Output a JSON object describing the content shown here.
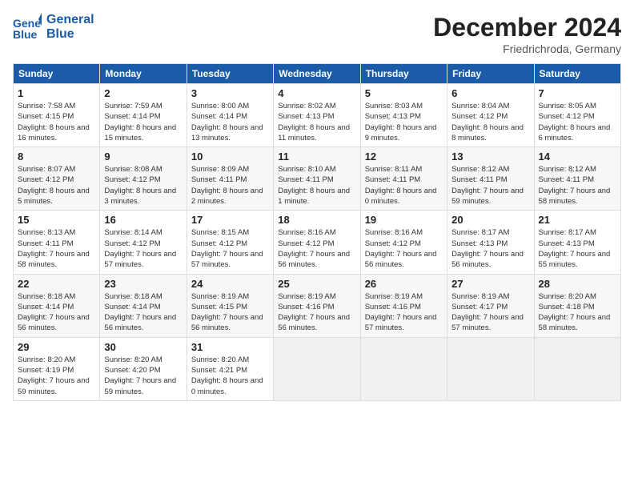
{
  "header": {
    "logo_line1": "General",
    "logo_line2": "Blue",
    "month": "December 2024",
    "location": "Friedrichroda, Germany"
  },
  "weekdays": [
    "Sunday",
    "Monday",
    "Tuesday",
    "Wednesday",
    "Thursday",
    "Friday",
    "Saturday"
  ],
  "weeks": [
    [
      {
        "day": "1",
        "sunrise": "Sunrise: 7:58 AM",
        "sunset": "Sunset: 4:15 PM",
        "daylight": "Daylight: 8 hours and 16 minutes."
      },
      {
        "day": "2",
        "sunrise": "Sunrise: 7:59 AM",
        "sunset": "Sunset: 4:14 PM",
        "daylight": "Daylight: 8 hours and 15 minutes."
      },
      {
        "day": "3",
        "sunrise": "Sunrise: 8:00 AM",
        "sunset": "Sunset: 4:14 PM",
        "daylight": "Daylight: 8 hours and 13 minutes."
      },
      {
        "day": "4",
        "sunrise": "Sunrise: 8:02 AM",
        "sunset": "Sunset: 4:13 PM",
        "daylight": "Daylight: 8 hours and 11 minutes."
      },
      {
        "day": "5",
        "sunrise": "Sunrise: 8:03 AM",
        "sunset": "Sunset: 4:13 PM",
        "daylight": "Daylight: 8 hours and 9 minutes."
      },
      {
        "day": "6",
        "sunrise": "Sunrise: 8:04 AM",
        "sunset": "Sunset: 4:12 PM",
        "daylight": "Daylight: 8 hours and 8 minutes."
      },
      {
        "day": "7",
        "sunrise": "Sunrise: 8:05 AM",
        "sunset": "Sunset: 4:12 PM",
        "daylight": "Daylight: 8 hours and 6 minutes."
      }
    ],
    [
      {
        "day": "8",
        "sunrise": "Sunrise: 8:07 AM",
        "sunset": "Sunset: 4:12 PM",
        "daylight": "Daylight: 8 hours and 5 minutes."
      },
      {
        "day": "9",
        "sunrise": "Sunrise: 8:08 AM",
        "sunset": "Sunset: 4:12 PM",
        "daylight": "Daylight: 8 hours and 3 minutes."
      },
      {
        "day": "10",
        "sunrise": "Sunrise: 8:09 AM",
        "sunset": "Sunset: 4:11 PM",
        "daylight": "Daylight: 8 hours and 2 minutes."
      },
      {
        "day": "11",
        "sunrise": "Sunrise: 8:10 AM",
        "sunset": "Sunset: 4:11 PM",
        "daylight": "Daylight: 8 hours and 1 minute."
      },
      {
        "day": "12",
        "sunrise": "Sunrise: 8:11 AM",
        "sunset": "Sunset: 4:11 PM",
        "daylight": "Daylight: 8 hours and 0 minutes."
      },
      {
        "day": "13",
        "sunrise": "Sunrise: 8:12 AM",
        "sunset": "Sunset: 4:11 PM",
        "daylight": "Daylight: 7 hours and 59 minutes."
      },
      {
        "day": "14",
        "sunrise": "Sunrise: 8:12 AM",
        "sunset": "Sunset: 4:11 PM",
        "daylight": "Daylight: 7 hours and 58 minutes."
      }
    ],
    [
      {
        "day": "15",
        "sunrise": "Sunrise: 8:13 AM",
        "sunset": "Sunset: 4:11 PM",
        "daylight": "Daylight: 7 hours and 58 minutes."
      },
      {
        "day": "16",
        "sunrise": "Sunrise: 8:14 AM",
        "sunset": "Sunset: 4:12 PM",
        "daylight": "Daylight: 7 hours and 57 minutes."
      },
      {
        "day": "17",
        "sunrise": "Sunrise: 8:15 AM",
        "sunset": "Sunset: 4:12 PM",
        "daylight": "Daylight: 7 hours and 57 minutes."
      },
      {
        "day": "18",
        "sunrise": "Sunrise: 8:16 AM",
        "sunset": "Sunset: 4:12 PM",
        "daylight": "Daylight: 7 hours and 56 minutes."
      },
      {
        "day": "19",
        "sunrise": "Sunrise: 8:16 AM",
        "sunset": "Sunset: 4:12 PM",
        "daylight": "Daylight: 7 hours and 56 minutes."
      },
      {
        "day": "20",
        "sunrise": "Sunrise: 8:17 AM",
        "sunset": "Sunset: 4:13 PM",
        "daylight": "Daylight: 7 hours and 56 minutes."
      },
      {
        "day": "21",
        "sunrise": "Sunrise: 8:17 AM",
        "sunset": "Sunset: 4:13 PM",
        "daylight": "Daylight: 7 hours and 55 minutes."
      }
    ],
    [
      {
        "day": "22",
        "sunrise": "Sunrise: 8:18 AM",
        "sunset": "Sunset: 4:14 PM",
        "daylight": "Daylight: 7 hours and 56 minutes."
      },
      {
        "day": "23",
        "sunrise": "Sunrise: 8:18 AM",
        "sunset": "Sunset: 4:14 PM",
        "daylight": "Daylight: 7 hours and 56 minutes."
      },
      {
        "day": "24",
        "sunrise": "Sunrise: 8:19 AM",
        "sunset": "Sunset: 4:15 PM",
        "daylight": "Daylight: 7 hours and 56 minutes."
      },
      {
        "day": "25",
        "sunrise": "Sunrise: 8:19 AM",
        "sunset": "Sunset: 4:16 PM",
        "daylight": "Daylight: 7 hours and 56 minutes."
      },
      {
        "day": "26",
        "sunrise": "Sunrise: 8:19 AM",
        "sunset": "Sunset: 4:16 PM",
        "daylight": "Daylight: 7 hours and 57 minutes."
      },
      {
        "day": "27",
        "sunrise": "Sunrise: 8:19 AM",
        "sunset": "Sunset: 4:17 PM",
        "daylight": "Daylight: 7 hours and 57 minutes."
      },
      {
        "day": "28",
        "sunrise": "Sunrise: 8:20 AM",
        "sunset": "Sunset: 4:18 PM",
        "daylight": "Daylight: 7 hours and 58 minutes."
      }
    ],
    [
      {
        "day": "29",
        "sunrise": "Sunrise: 8:20 AM",
        "sunset": "Sunset: 4:19 PM",
        "daylight": "Daylight: 7 hours and 59 minutes."
      },
      {
        "day": "30",
        "sunrise": "Sunrise: 8:20 AM",
        "sunset": "Sunset: 4:20 PM",
        "daylight": "Daylight: 7 hours and 59 minutes."
      },
      {
        "day": "31",
        "sunrise": "Sunrise: 8:20 AM",
        "sunset": "Sunset: 4:21 PM",
        "daylight": "Daylight: 8 hours and 0 minutes."
      },
      null,
      null,
      null,
      null
    ]
  ]
}
